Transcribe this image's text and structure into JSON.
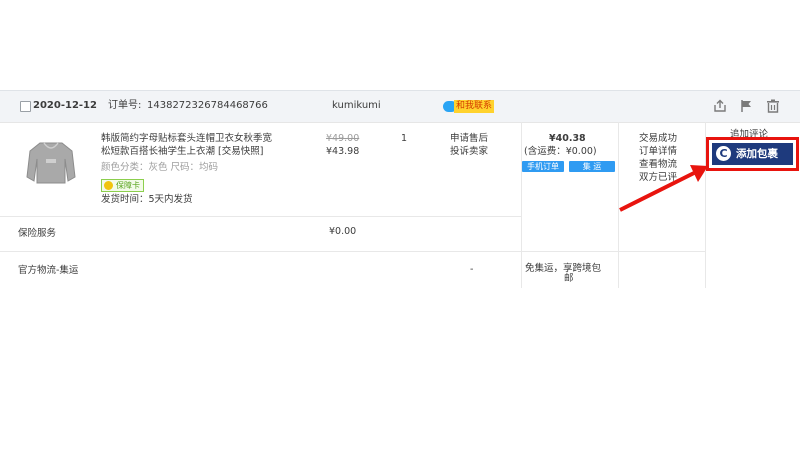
{
  "order": {
    "date": "2020-12-12",
    "order_no_label": "订单号:",
    "order_no": "1438272326784468766",
    "seller": "kumikumi",
    "contact_label": "和我联系"
  },
  "item": {
    "title_line1": "韩版简约字母贴标套头连帽卫衣女秋季宽",
    "title_line2": "松短款百搭长袖学生上衣潮 [交易快照]",
    "attrs": "颜色分类：灰色  尺码：均码",
    "guarantee_label": "保障卡",
    "ship_time": "发货时间：5天内发货",
    "price_original": "¥49.00",
    "price_current": "¥43.98",
    "quantity": "1",
    "service_links": [
      "申请售后",
      "投诉卖家"
    ]
  },
  "total": {
    "amount": "¥40.38",
    "shipping_note": "(含运费：¥0.00)",
    "tag_mobile": "手机订单",
    "tag_consolidated": "集 运"
  },
  "status": {
    "items": [
      "交易成功",
      "订单详情",
      "查看物流",
      "双方已评"
    ]
  },
  "actions": {
    "review_label": "追加评论",
    "add_package_label": "添加包裹"
  },
  "insurance": {
    "label": "保险服务",
    "price": "¥0.00"
  },
  "logistics": {
    "label": "官方物流-集运",
    "dash": "-",
    "note_line1": "免集运，享跨境包",
    "note_line2": "邮"
  },
  "colors": {
    "header_bg": "#f2f4f7",
    "tag_blue": "#2f9bf2",
    "highlight_red": "#e8140e",
    "button_navy": "#1e3a7d"
  }
}
